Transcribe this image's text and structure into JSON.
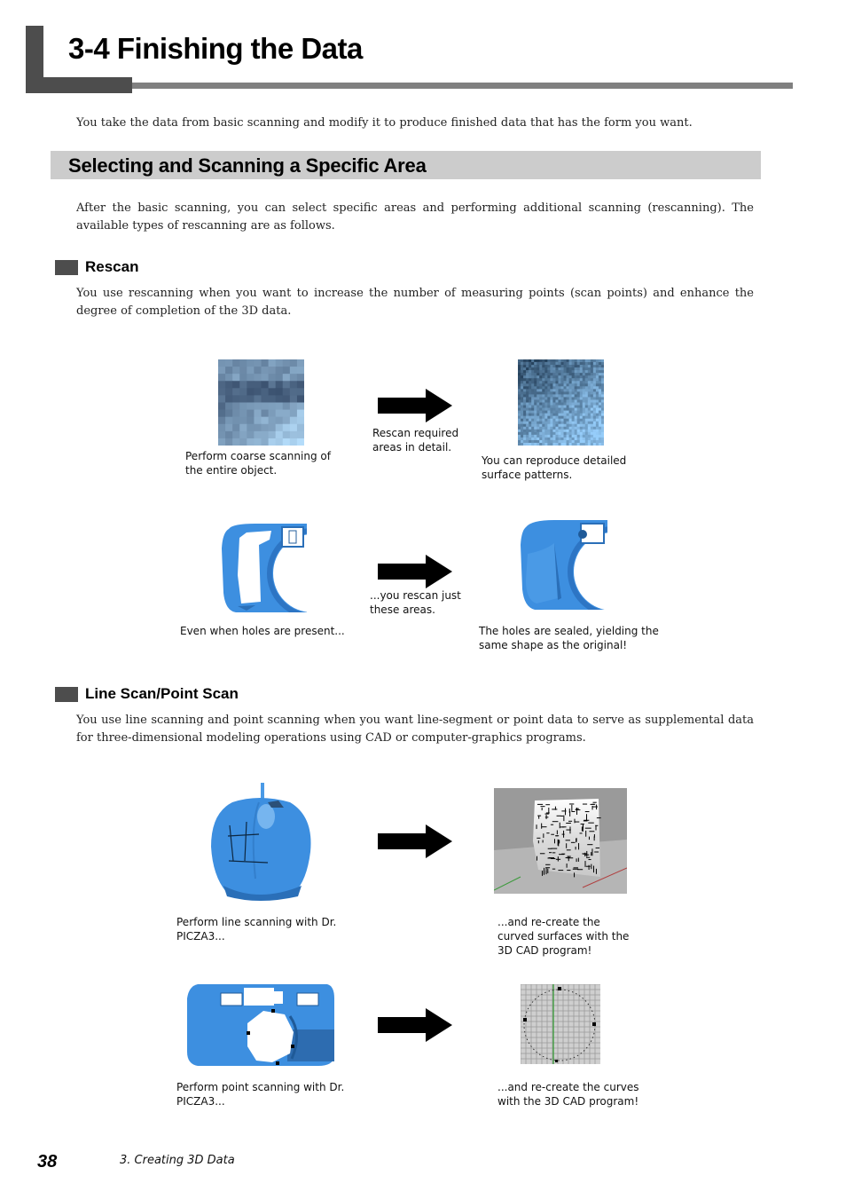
{
  "chapter": {
    "title": "3-4 Finishing the Data",
    "intro": "You take the data from basic scanning and modify it to produce finished data that has the form you want."
  },
  "section": {
    "title": "Selecting and Scanning a Specific Area",
    "paragraph": "After the basic scanning, you can select specific areas and performing additional scanning (rescanning). The available types of rescanning are as follows."
  },
  "rescan": {
    "title": "Rescan",
    "paragraph": "You use rescanning when you want to increase the number of measuring points (scan points) and enhance the degree of completion of the 3D data.",
    "row1": {
      "left_caption": "Perform coarse scanning of the entire object.",
      "arrow_caption": "Rescan required areas in detail.",
      "right_caption": "You can reproduce detailed surface patterns."
    },
    "row2": {
      "left_caption": "Even when holes are present...",
      "arrow_caption": "...you rescan just these areas.",
      "right_caption": "The holes are sealed, yielding the same shape as the original!"
    }
  },
  "linescan": {
    "title": "Line Scan/Point Scan",
    "paragraph": "You use line scanning and point scanning when you want line-segment or point data to serve as supplemental data for three-dimensional modeling operations using CAD or computer-graphics programs.",
    "row1": {
      "left_caption": "Perform line scanning with Dr. PICZA3...",
      "right_caption": "...and re-create the curved surfaces with the 3D CAD program!"
    },
    "row2": {
      "left_caption": "Perform point scanning with Dr. PICZA3...",
      "right_caption": "...and re-create the curves with the 3D CAD program!"
    }
  },
  "footer": {
    "page_number": "38",
    "chapter_label": "3. Creating 3D Data"
  },
  "colors": {
    "header_dark": "#4d4d4d",
    "header_line": "#808080",
    "section_band": "#cccccc",
    "scan_blue": "#3b8fe0"
  }
}
